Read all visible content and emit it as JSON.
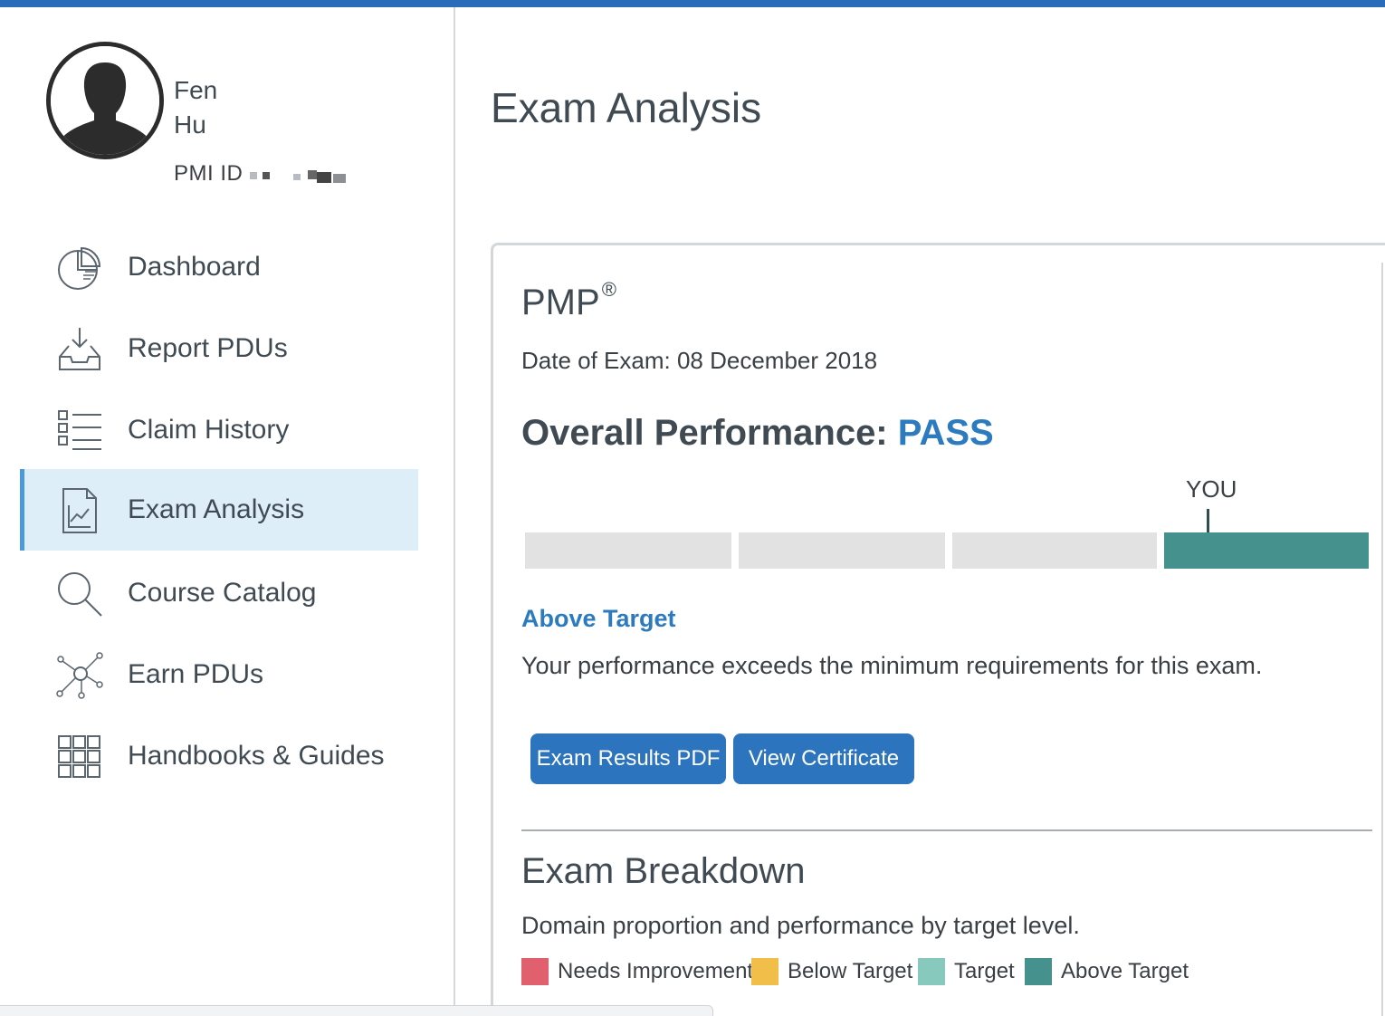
{
  "user": {
    "first_name": "Fen",
    "last_name": "Hu",
    "id_label": "PMI ID"
  },
  "sidebar": {
    "items": [
      {
        "label": "Dashboard",
        "icon": "pie-chart-icon",
        "active": false
      },
      {
        "label": "Report PDUs",
        "icon": "inbox-download-icon",
        "active": false
      },
      {
        "label": "Claim History",
        "icon": "list-icon",
        "active": false
      },
      {
        "label": "Exam Analysis",
        "icon": "chart-document-icon",
        "active": true
      },
      {
        "label": "Course Catalog",
        "icon": "search-icon",
        "active": false
      },
      {
        "label": "Earn PDUs",
        "icon": "network-icon",
        "active": false
      },
      {
        "label": "Handbooks & Guides",
        "icon": "grid-icon",
        "active": false
      }
    ]
  },
  "main": {
    "title": "Exam Analysis",
    "exam": {
      "name": "PMP",
      "reg_mark": "®",
      "date": "Date of Exam: 08 December 2018",
      "overall_label": "Overall Performance: ",
      "overall_result": "PASS"
    },
    "performance_bar": {
      "marker_label": "YOU",
      "segments": 4,
      "filled_segment": 4
    },
    "level": {
      "title": "Above Target",
      "description": "Your performance exceeds the minimum requirements for this exam."
    },
    "buttons": {
      "results_pdf": "Exam Results PDF",
      "certificate": "View Certificate"
    },
    "breakdown": {
      "title": "Exam Breakdown",
      "description": "Domain proportion and performance by target level.",
      "legend": [
        {
          "label": "Needs Improvement",
          "color": "#e0606e"
        },
        {
          "label": "Below Target",
          "color": "#f2be4a"
        },
        {
          "label": "Target",
          "color": "#88c9bd"
        },
        {
          "label": "Above Target",
          "color": "#45918d"
        }
      ]
    }
  },
  "colors": {
    "accent": "#2c74bd",
    "top_bar": "#2a6cb8",
    "active_nav_bg": "#ddeef9",
    "bar_filled": "#45918d",
    "bar_empty": "#e2e2e2"
  }
}
